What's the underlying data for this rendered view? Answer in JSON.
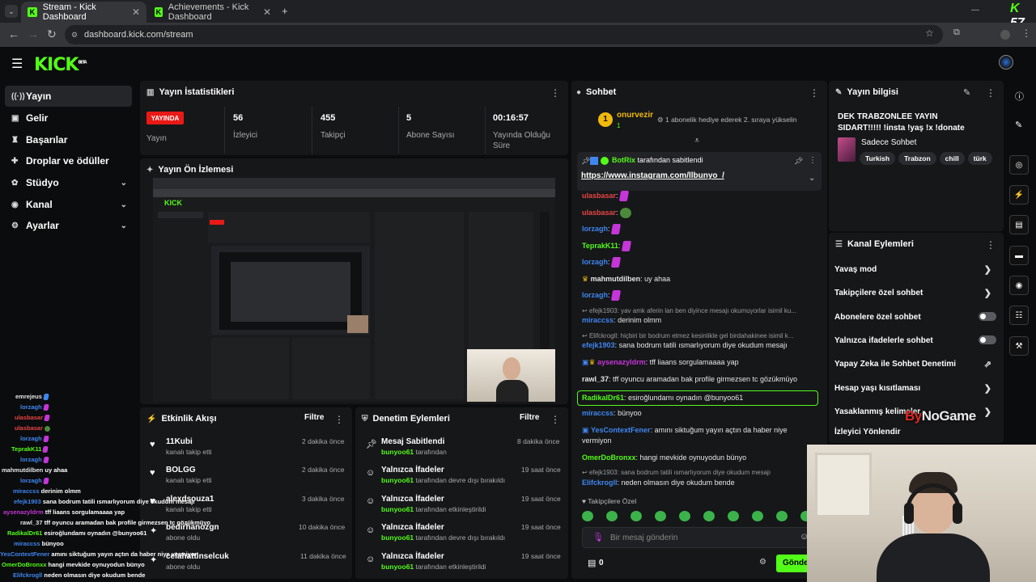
{
  "browser": {
    "tabs": [
      {
        "title": "Stream - Kick Dashboard",
        "active": true
      },
      {
        "title": "Achievements - Kick Dashboard",
        "active": false
      }
    ],
    "url": "dashboard.kick.com/stream",
    "corner_logo": "57"
  },
  "header": {
    "logo": "KICK",
    "logo_sup": "BETA"
  },
  "sidebar": {
    "items": [
      {
        "label": "Yayın",
        "icon": "broadcast-icon"
      },
      {
        "label": "Gelir",
        "icon": "dollar-icon"
      },
      {
        "label": "Başarılar",
        "icon": "trophy-icon"
      },
      {
        "label": "Droplar ve ödüller",
        "icon": "gift-icon"
      },
      {
        "label": "Stüdyo",
        "icon": "studio-icon"
      },
      {
        "label": "Kanal",
        "icon": "channel-icon"
      },
      {
        "label": "Ayarlar",
        "icon": "gear-icon"
      }
    ]
  },
  "stats": {
    "title": "Yayın İstatistikleri",
    "live": "YAYINDA",
    "live_label": "Yayın",
    "viewers_value": "56",
    "viewers_label": "İzleyici",
    "followers_value": "455",
    "followers_label": "Takipçi",
    "subs_value": "5",
    "subs_label": "Abone Sayısı",
    "duration_value": "00:16:57",
    "duration_label": "Yayında Olduğu Süre"
  },
  "preview": {
    "title": "Yayın Ön İzlemesi"
  },
  "activity": {
    "title": "Etkinlik Akışı",
    "filter": "Filtre",
    "items": [
      {
        "name": "11Kubi",
        "sub": "kanalı takip etti",
        "time": "2 dakika önce"
      },
      {
        "name": "BOLGG",
        "sub": "kanalı takip etti",
        "time": "2 dakika önce"
      },
      {
        "name": "alexdsouza1",
        "sub": "kanalı takip etti",
        "time": "3 dakika önce"
      },
      {
        "name": "bedirhanozgn",
        "sub": "abone oldu",
        "time": "10 dakika önce"
      },
      {
        "name": "celahattinselcuk",
        "sub": "abone oldu",
        "time": "11 dakika önce"
      }
    ]
  },
  "moderation": {
    "title": "Denetim Eylemleri",
    "filter": "Filtre",
    "items": [
      {
        "name": "Mesaj Sabitlendi",
        "actor": "bunyoo61",
        "sub": "tarafından",
        "time": "8 dakika önce"
      },
      {
        "name": "Yalnızca İfadeler",
        "actor": "bunyoo61",
        "sub": "tarafından devre dışı bırakıldı",
        "time": "19 saat önce"
      },
      {
        "name": "Yalnızca İfadeler",
        "actor": "bunyoo61",
        "sub": "tarafından etkinleştirildi",
        "time": "19 saat önce"
      },
      {
        "name": "Yalnızca İfadeler",
        "actor": "bunyoo61",
        "sub": "tarafından devre dışı bırakıldı",
        "time": "19 saat önce"
      },
      {
        "name": "Yalnızca İfadeler",
        "actor": "bunyoo61",
        "sub": "tarafından etkinleştirildi",
        "time": "19 saat önce"
      }
    ]
  },
  "chat": {
    "title": "Sohbet",
    "top_user": "onurvezir",
    "top_user_count": "1",
    "top_gift": "1 abonelik hediye ederek 2. sıraya yükselin",
    "pinned_by": "BotRix",
    "pinned_label": "tarafından sabitlendi",
    "pinned_link": "https://www.instagram.com/llbunyo_/",
    "messages": [
      {
        "user": "ulasbasar",
        "color": "#e84545",
        "text": ""
      },
      {
        "user": "ulasbasar",
        "color": "#e84545",
        "text": ""
      },
      {
        "user": "lorzagh",
        "color": "#3f86f0",
        "text": ""
      },
      {
        "user": "TeprakK11",
        "color": "#53fc18",
        "text": ""
      },
      {
        "user": "lorzagh",
        "color": "#3f86f0",
        "text": ""
      },
      {
        "user": "mahmutdilben",
        "color": "#e6e6e6",
        "text": "uy ahaa"
      },
      {
        "user": "lorzagh",
        "color": "#3f86f0",
        "text": ""
      }
    ],
    "reply1": "efejk1903: yav amk aferin lan ben diyince mesajı okumuyorlar isimil ku...",
    "msg_miraccss1_user": "miraccss",
    "msg_miraccss1": "derinim olmm",
    "reply2": "Elifckrogll: hiçbiri bir bodrum etmez kesinlikle gel birdahakinee isimil k...",
    "msg_efejk_user": "efejk1903",
    "msg_efejk": "sana bodrum tatili ısmarlıyorum diye okudum mesajı",
    "msg_aysen_user": "aysenazyldrm",
    "msg_aysen": "tff liaans sorgulamaaaa yap",
    "msg_rawl_user": "rawl_37",
    "msg_rawl": "tff oyuncu aramadan bak profile girmezsen tc gözükmüyo",
    "msg_radikal_user": "RadikalDr61",
    "msg_radikal": "esiroğlundamı oynadın @bunyoo61",
    "msg_miraccss2_user": "miraccss",
    "msg_miraccss2": "bünyoo",
    "msg_yes_user": "YesContextFener",
    "msg_yes": "amını siktuğum yayın açtın da haber niye vermiyon",
    "msg_omer_user": "OmerDoBronxx",
    "msg_omer": "hangi mevkide oynuyodun bünyo",
    "reply3": "efejk1903: sana bodrum tatili ısmarlıyorum diye okudum mesajı",
    "msg_elif_user": "Elifckrogll",
    "msg_elif": "neden olmasın diye okudum bende",
    "followers_only": "Takipçilere Özel",
    "input_placeholder": "Bir mesaj gönderin",
    "points": "0",
    "send": "Gönde"
  },
  "stream_info": {
    "title": "Yayın bilgisi",
    "stream_title": "DEK TRABZONLEE YAYIN SIDART!!!!! !insta !yaş !x !donate",
    "category": "Sadece Sohbet",
    "tags": [
      "Turkish",
      "Trabzon",
      "chill",
      "türk"
    ]
  },
  "channel_actions": {
    "title": "Kanal Eylemleri",
    "items": [
      {
        "label": "Yavaş mod",
        "control": "arrow"
      },
      {
        "label": "Takipçilere özel sohbet",
        "control": "arrow"
      },
      {
        "label": "Abonelere özel sohbet",
        "control": "toggle"
      },
      {
        "label": "Yalnızca ifadelerle sohbet",
        "control": "toggle"
      },
      {
        "label": "Yapay Zeka ile Sohbet Denetimi",
        "control": "external"
      },
      {
        "label": "Hesap yaşı kısıtlaması",
        "control": "arrow"
      },
      {
        "label": "Yasaklanmış kelimeler",
        "control": "arrow"
      },
      {
        "label": "İzleyici Yönlendir",
        "control": "none"
      }
    ]
  },
  "overlay_chat": [
    {
      "user": "emrejeus",
      "color": "#e6e6e6",
      "text": ""
    },
    {
      "user": "lorzagh",
      "color": "#3f86f0",
      "text": ""
    },
    {
      "user": "ulasbasar",
      "color": "#e84545",
      "text": ""
    },
    {
      "user": "ulasbasar",
      "color": "#e84545",
      "text": ""
    },
    {
      "user": "lorzagh",
      "color": "#3f86f0",
      "text": ""
    },
    {
      "user": "TeprakK11",
      "color": "#53fc18",
      "text": ""
    },
    {
      "user": "lorzagh",
      "color": "#3f86f0",
      "text": ""
    },
    {
      "user": "mahmutdilben",
      "color": "#e6e6e6",
      "text": "uy ahaa"
    },
    {
      "user": "lorzagh",
      "color": "#3f86f0",
      "text": ""
    },
    {
      "user": "miraccss",
      "color": "#3f86f0",
      "text": "derinim olmm"
    },
    {
      "user": "efejk1903",
      "color": "#3f86f0",
      "text": "sana bodrum tatili ısmarlıyorum diye okudum mesajı"
    },
    {
      "user": "aysenazyldrm",
      "color": "#c535d8",
      "text": "tff liaans sorgulamaaaa yap"
    },
    {
      "user": "rawl_37",
      "color": "#e6e6e6",
      "text": "tff oyuncu aramadan bak profile girmezsen tc gözükmüyo"
    },
    {
      "user": "RadikalDr61",
      "color": "#53fc18",
      "text": "esiroğlundamı oynadın @bunyoo61"
    },
    {
      "user": "miraccss",
      "color": "#3f86f0",
      "text": "bünyoo"
    },
    {
      "user": "YesContextFener",
      "color": "#3f86f0",
      "text": "amını siktuğum yayın açtın da haber niye vermiyon"
    },
    {
      "user": "OmerDoBronxx",
      "color": "#53fc18",
      "text": "hangi mevkide oynuyodun bünyo"
    },
    {
      "user": "Elifckrogll",
      "color": "#3f86f0",
      "text": "neden olmasın diye okudum bende"
    }
  ],
  "watermark": {
    "part1": "By",
    "part2": "NoGame"
  },
  "colors": {
    "accent": "#53fc18",
    "live": "#e91916",
    "panel": "#161719",
    "bg": "#0b0c0d"
  }
}
